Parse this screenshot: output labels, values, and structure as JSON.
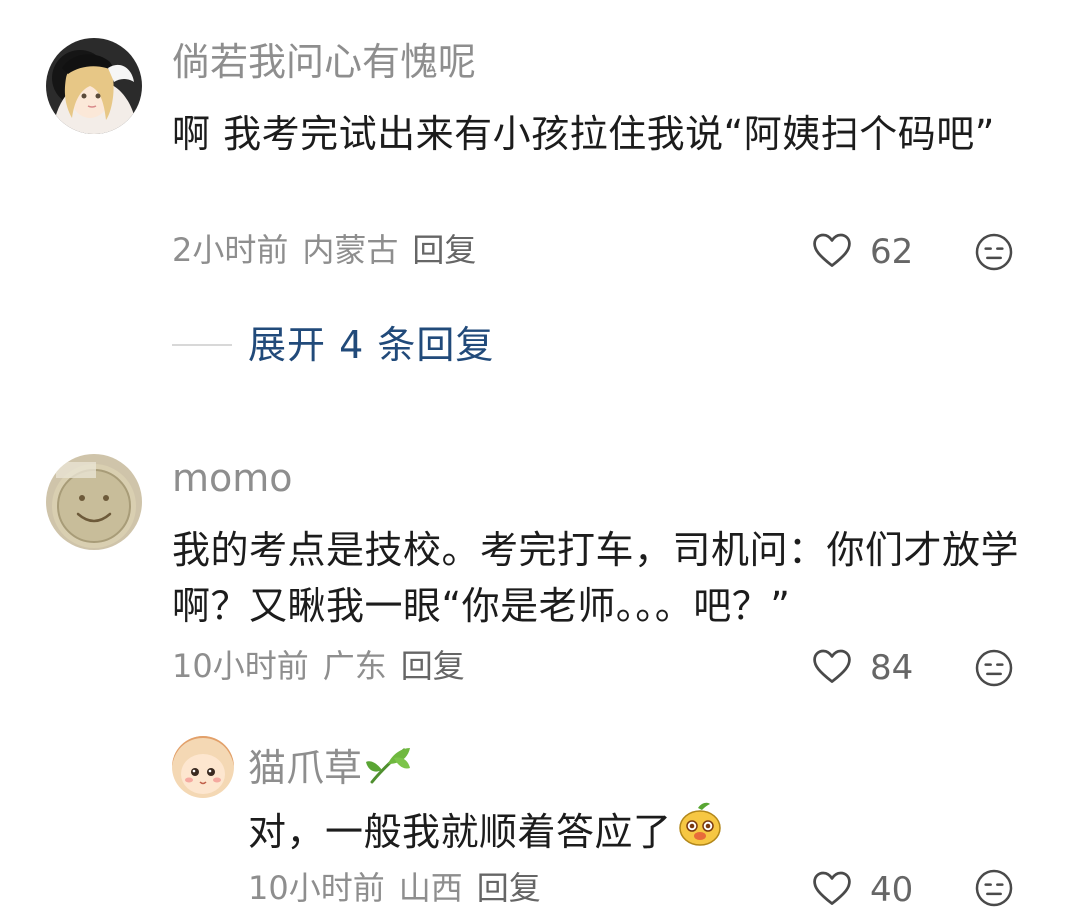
{
  "comments": [
    {
      "username": "倘若我问心有愧呢",
      "text": "啊 我考完试出来有小孩拉住我说“阿姨扫个码吧”",
      "time": "2小时前",
      "location": "内蒙古",
      "reply_label": "回复",
      "likes": "62",
      "expand_label": "展开 4 条回复"
    },
    {
      "username": "momo",
      "text": "我的考点是技校。考完打车，司机问：你们才放学啊？又瞅我一眼“你是老师。。。吧？”",
      "time": "10小时前",
      "location": "广东",
      "reply_label": "回复",
      "likes": "84",
      "reply": {
        "username": "猫爪草",
        "text": "对，一般我就顺着答应了",
        "time": "10小时前",
        "location": "山西",
        "reply_label": "回复",
        "likes": "40"
      }
    }
  ],
  "icons": {
    "like": "heart-outline-icon",
    "dislike": "meh-face-icon",
    "username_badge": "leaf-icon",
    "emoji": "mango-emoji-icon"
  },
  "colors": {
    "username": "#8e8e8e",
    "meta": "#8e8e8e",
    "expand_link": "#214a7a",
    "text": "#1c1c1c"
  }
}
